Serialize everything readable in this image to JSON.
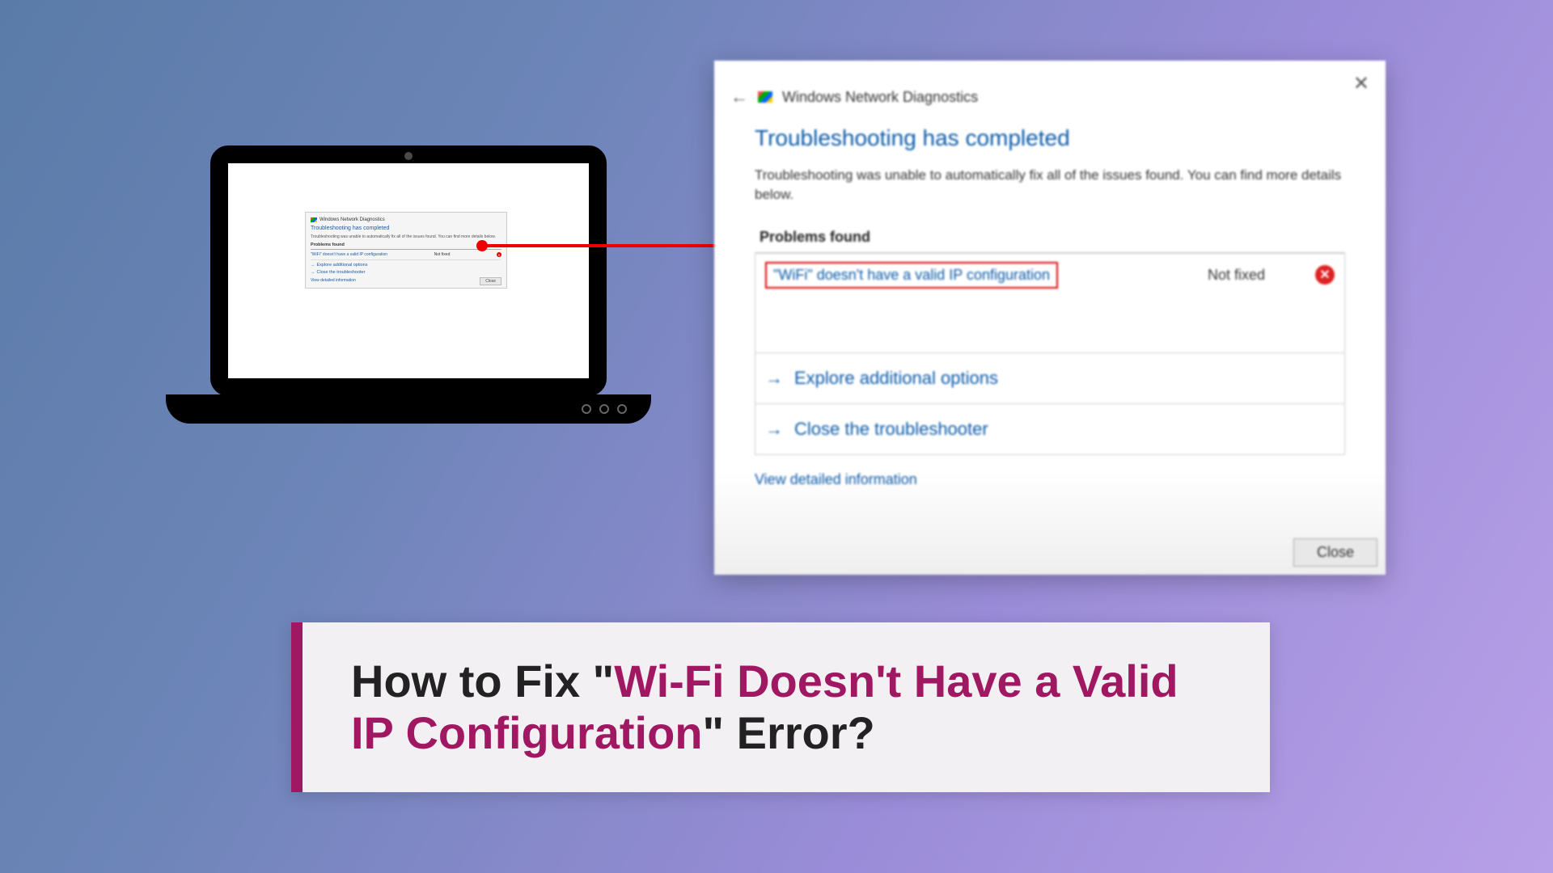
{
  "dialog": {
    "window_title": "Windows Network Diagnostics",
    "header": "Troubleshooting has completed",
    "subtext": "Troubleshooting was unable to automatically fix all of the issues found. You can find more details below.",
    "problems_label": "Problems found",
    "problem_text": "\"WiFi\" doesn't have a valid IP configuration",
    "status": "Not fixed",
    "option_explore": "Explore additional options",
    "option_close": "Close the troubleshooter",
    "view_details": "View detailed information",
    "close_button": "Close"
  },
  "title": {
    "prefix": "How to Fix \"",
    "highlight": "Wi-Fi Doesn't Have a Valid IP Configuration",
    "suffix": "\" Error?"
  }
}
